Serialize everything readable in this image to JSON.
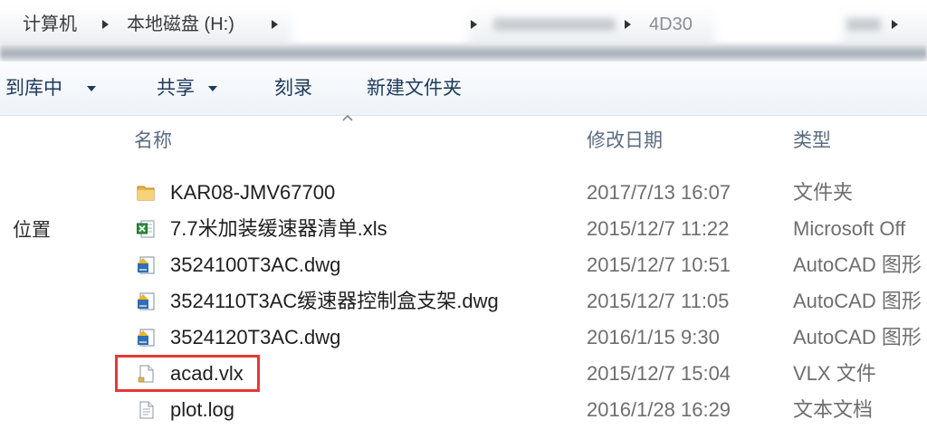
{
  "address_bar": {
    "crumbs": [
      {
        "label": "计算机"
      },
      {
        "label": "本地磁盘 (H:)"
      },
      {
        "label": "4D30"
      }
    ]
  },
  "toolbar": {
    "items": [
      {
        "label": "到库中",
        "has_dropdown": true
      },
      {
        "label": "共享",
        "has_dropdown": true
      },
      {
        "label": "刻录",
        "has_dropdown": false
      },
      {
        "label": "新建文件夹",
        "has_dropdown": false
      }
    ]
  },
  "nav_pane": {
    "items": [
      {
        "label": "位置"
      }
    ]
  },
  "columns": [
    {
      "label": "名称",
      "sort": "ascending"
    },
    {
      "label": "修改日期"
    },
    {
      "label": "类型"
    }
  ],
  "files": [
    {
      "name": "KAR08-JMV67700",
      "modified": "2017/7/13 16:07",
      "type": "文件夹",
      "icon": "folder-icon"
    },
    {
      "name": "7.7米加装缓速器清单.xls",
      "modified": "2015/12/7 11:22",
      "type": "Microsoft Off",
      "icon": "excel-file-icon"
    },
    {
      "name": "3524100T3AC.dwg",
      "modified": "2015/12/7 10:51",
      "type": "AutoCAD 图形",
      "icon": "autocad-file-icon"
    },
    {
      "name": "3524110T3AC缓速器控制盒支架.dwg",
      "modified": "2015/12/7 11:05",
      "type": "AutoCAD 图形",
      "icon": "autocad-file-icon"
    },
    {
      "name": "3524120T3AC.dwg",
      "modified": "2016/1/15 9:30",
      "type": "AutoCAD 图形",
      "icon": "autocad-file-icon"
    },
    {
      "name": "acad.vlx",
      "modified": "2015/12/7 15:04",
      "type": "VLX 文件",
      "icon": "vlx-file-icon",
      "highlighted": true
    },
    {
      "name": "plot.log",
      "modified": "2016/1/28 16:29",
      "type": "文本文档",
      "icon": "text-file-icon"
    }
  ],
  "colors": {
    "highlight": "#e53935",
    "toolbar_text": "#1e3a5c",
    "header_text": "#5b6b80",
    "name_text": "#1f1f1f",
    "meta_text": "#6e6e6e"
  }
}
